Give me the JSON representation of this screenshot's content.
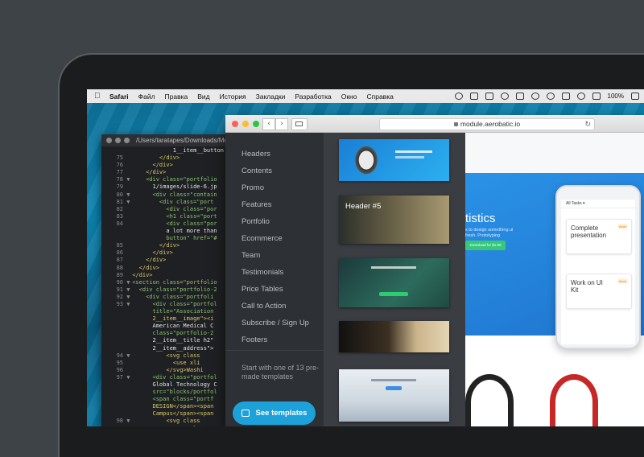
{
  "menubar": {
    "apple_icon": "apple-icon",
    "items": [
      "Safari",
      "Файл",
      "Правка",
      "Вид",
      "История",
      "Закладки",
      "Разработка",
      "Окно",
      "Справка"
    ],
    "battery": "100%"
  },
  "terminal": {
    "path": "/Users/taratapes/Downloads/Mo",
    "lines": [
      {
        "n": "",
        "a": "",
        "t": "            1__item__button"
      },
      {
        "n": "75",
        "a": "",
        "t": "        </div>"
      },
      {
        "n": "76",
        "a": "",
        "t": "      </div>"
      },
      {
        "n": "77",
        "a": "",
        "t": "    </div>"
      },
      {
        "n": "78",
        "a": "▼",
        "t": "    <div class=\"portfolio"
      },
      {
        "n": "79",
        "a": "",
        "t": "      1/images/slide-6.jp"
      },
      {
        "n": "80",
        "a": "▼",
        "t": "      <div class=\"contain"
      },
      {
        "n": "81",
        "a": "▼",
        "t": "        <div class=\"port"
      },
      {
        "n": "82",
        "a": "",
        "t": "          <div class=\"por"
      },
      {
        "n": "83",
        "a": "",
        "t": "          <h1 class=\"port"
      },
      {
        "n": "84",
        "a": "",
        "t": "          <div class=\"por"
      },
      {
        "n": "",
        "a": "",
        "t": "          a lot more than"
      },
      {
        "n": "",
        "a": "",
        "t": "          button\" href=\"#"
      },
      {
        "n": "85",
        "a": "",
        "t": "        </div>"
      },
      {
        "n": "86",
        "a": "",
        "t": "      </div>"
      },
      {
        "n": "87",
        "a": "",
        "t": "    </div>"
      },
      {
        "n": "88",
        "a": "",
        "t": "  </div>"
      },
      {
        "n": "89",
        "a": "",
        "t": "</div>"
      },
      {
        "n": "90",
        "a": "▼",
        "t": "<section class=\"portfolio"
      },
      {
        "n": "91",
        "a": "▼",
        "t": "  <div class=\"portfolio-2"
      },
      {
        "n": "92",
        "a": "▼",
        "t": "    <div class=\"portfoli"
      },
      {
        "n": "93",
        "a": "▼",
        "t": "      <div class=\"portfol"
      },
      {
        "n": "",
        "a": "",
        "t": "      title=\"Association"
      },
      {
        "n": "",
        "a": "",
        "t": "      2__item__image\"><i"
      },
      {
        "n": "",
        "a": "",
        "t": "      American Medical C"
      },
      {
        "n": "",
        "a": "",
        "t": "      class=\"portfolio-2"
      },
      {
        "n": "",
        "a": "",
        "t": "      2__item__title h2\""
      },
      {
        "n": "",
        "a": "",
        "t": "      2__item__address\">"
      },
      {
        "n": "94",
        "a": "▼",
        "t": "          <svg class"
      },
      {
        "n": "95",
        "a": "",
        "t": "            <use xli"
      },
      {
        "n": "96",
        "a": "",
        "t": "          </svg>Washi"
      },
      {
        "n": "97",
        "a": "▼",
        "t": "      <div class=\"portfol"
      },
      {
        "n": "",
        "a": "",
        "t": "      Global Technology C"
      },
      {
        "n": "",
        "a": "",
        "t": "      src=\"blocks/portfol"
      },
      {
        "n": "",
        "a": "",
        "t": "      <span class=\"portf"
      },
      {
        "n": "",
        "a": "",
        "t": "      DESIGN</span><span"
      },
      {
        "n": "",
        "a": "",
        "t": "      Campus</span><span "
      },
      {
        "n": "98",
        "a": "▼",
        "t": "          <svg class"
      },
      {
        "n": "99",
        "a": "",
        "t": "            <use xl"
      }
    ]
  },
  "browser": {
    "url": "module.aerobatic.io",
    "lock_icon": "lock-icon",
    "reload_icon": "reload-icon"
  },
  "panel": {
    "menu": [
      "Headers",
      "Contents",
      "Promo",
      "Features",
      "Portfolio",
      "Ecommerce",
      "Team",
      "Testimonials",
      "Price Tables",
      "Call to Action",
      "Subscribe / Sign Up",
      "Footers"
    ],
    "footer_text": "Start with one of 13 pre-made templates",
    "see_button": "See templates",
    "thumb_label": "Header #5"
  },
  "site": {
    "hero_title": "tistics",
    "hero_sub": "s to design something ul fresh. Prototyping",
    "hero_btn": "Download for $1.99",
    "phone_header": "All Tasks ▾",
    "task1": "Complete presentation",
    "task2": "Work on UI Kit",
    "badge": "Work"
  },
  "colors": {
    "panel_bg": "#2d3034",
    "accent": "#1ea0d8",
    "site_blue": "#2a92e6"
  }
}
